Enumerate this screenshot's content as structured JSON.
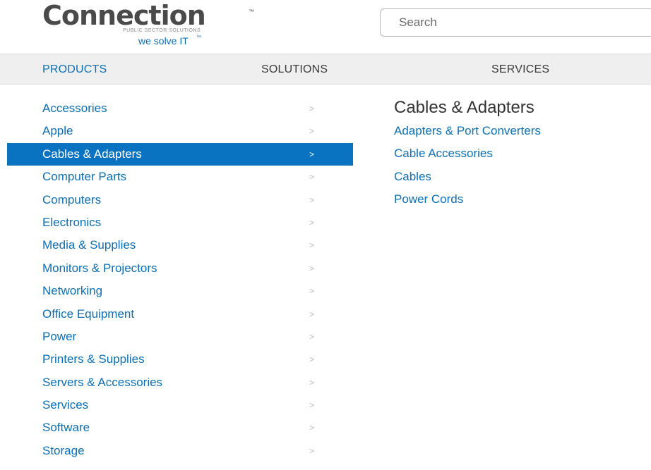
{
  "header": {
    "logo": {
      "wordmark": "Connection",
      "trademark": "™",
      "subtitle": "PUBLIC SECTOR SOLUTIONS",
      "slogan": "we solve IT",
      "slogan_tm": "™"
    },
    "search": {
      "placeholder": "Search",
      "value": ""
    }
  },
  "nav": {
    "items": [
      {
        "label": "PRODUCTS",
        "active": true
      },
      {
        "label": "SOLUTIONS",
        "active": false
      },
      {
        "label": "SERVICES",
        "active": false
      }
    ]
  },
  "categories": {
    "selected_index": 2,
    "chevron": ">",
    "items": [
      {
        "label": "Accessories"
      },
      {
        "label": "Apple"
      },
      {
        "label": "Cables & Adapters"
      },
      {
        "label": "Computer Parts"
      },
      {
        "label": "Computers"
      },
      {
        "label": "Electronics"
      },
      {
        "label": "Media & Supplies"
      },
      {
        "label": "Monitors & Projectors"
      },
      {
        "label": "Networking"
      },
      {
        "label": "Office Equipment"
      },
      {
        "label": "Power"
      },
      {
        "label": "Printers & Supplies"
      },
      {
        "label": "Servers & Accessories"
      },
      {
        "label": "Services"
      },
      {
        "label": "Software"
      },
      {
        "label": "Storage"
      }
    ]
  },
  "submenu": {
    "title": "Cables & Adapters",
    "items": [
      {
        "label": "Adapters & Port Converters"
      },
      {
        "label": "Cable Accessories"
      },
      {
        "label": "Cables"
      },
      {
        "label": "Power Cords"
      }
    ]
  },
  "colors": {
    "link": "#0b6fb8",
    "active_bg": "#0a73c1",
    "nav_bg": "#efefef",
    "chevron": "#b8b8b8"
  }
}
